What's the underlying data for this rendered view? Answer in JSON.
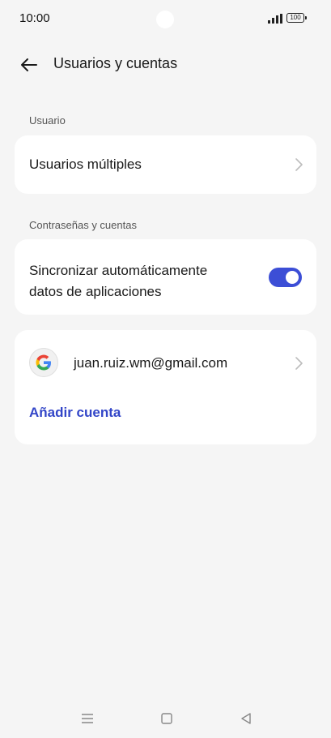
{
  "status": {
    "time": "10:00",
    "battery": "100"
  },
  "header": {
    "title": "Usuarios y cuentas"
  },
  "sections": {
    "user_label": "Usuario",
    "accounts_label": "Contraseñas y cuentas"
  },
  "users": {
    "multiple_label": "Usuarios múltiples"
  },
  "sync": {
    "label_line1": "Sincronizar automáticamente",
    "label_line2": "datos de aplicaciones",
    "enabled": true
  },
  "accounts": {
    "items": [
      {
        "email": "juan.ruiz.wm@gmail.com",
        "provider_icon": "google-icon"
      }
    ],
    "add_label": "Añadir cuenta"
  },
  "colors": {
    "accent": "#3c4ed6",
    "link": "#3346c8",
    "background": "#f5f5f5"
  },
  "nav": {
    "icons": [
      "menu-icon",
      "home-icon",
      "back-triangle-icon"
    ]
  }
}
